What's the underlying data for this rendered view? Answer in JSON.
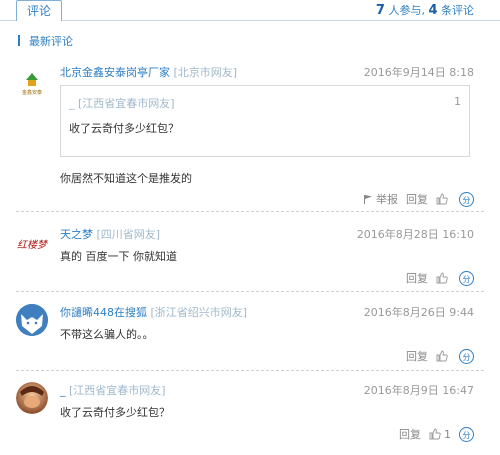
{
  "header": {
    "tab_label": "评论",
    "participants": "7",
    "participants_suffix": "人参与,",
    "comments": "4",
    "comments_suffix": "条评论"
  },
  "section_title": "最新评论",
  "comments": [
    {
      "avatar": "company-logo",
      "avatar_text": "金鑫安泰",
      "name": "北京金鑫安泰岗亭厂家",
      "location": "[北京市网友]",
      "date": "2016年9月14日 8:18",
      "quote": {
        "user": "_ [江西省宜春市网友]",
        "floor": "1",
        "text": "收了云奇付多少红包？"
      },
      "text": "你居然不知道这个是推发的",
      "report_label": "举报",
      "reply_label": "回复",
      "likes": ""
    },
    {
      "avatar": "calligraphy-logo",
      "avatar_text": "红楼梦",
      "name": "天之梦",
      "location": "[四川省网友]",
      "date": "2016年8月28日 16:10",
      "text": "真的 百度一下 你就知道",
      "reply_label": "回复",
      "likes": ""
    },
    {
      "avatar": "fox-avatar",
      "name": "你譴晞448在搜狐",
      "location": "[浙江省绍兴市网友]",
      "date": "2016年8月26日 9:44",
      "text": "不带这么骗人的。。",
      "reply_label": "回复",
      "likes": ""
    },
    {
      "avatar": "photo-avatar",
      "name": "_",
      "location": "[江西省宜春市网友]",
      "date": "2016年8月9日 16:47",
      "text": "收了云奇付多少红包？",
      "reply_label": "回复",
      "likes": "1"
    }
  ],
  "share_icon_text": "分",
  "colors": {
    "accent": "#2e7fc4",
    "meta": "#a0b8cc",
    "date": "#999999"
  }
}
